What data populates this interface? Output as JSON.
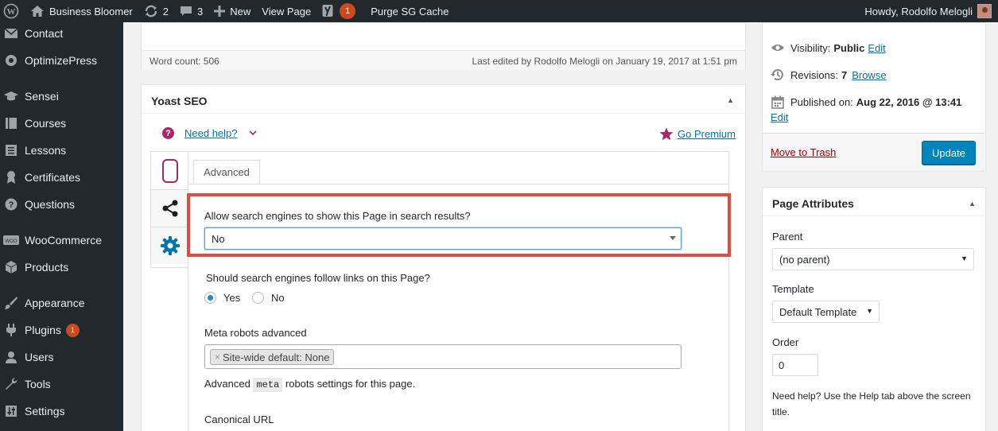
{
  "adminbar": {
    "site_name": "Business Bloomer",
    "updates_count": "2",
    "comments_count": "3",
    "new_label": "New",
    "view_page_label": "View Page",
    "yoast_badge": "1",
    "purge_label": "Purge SG Cache",
    "howdy": "Howdy, Rodolfo Melogli"
  },
  "sidebar": {
    "items": [
      {
        "label": "Contact",
        "icon": "envelope-icon"
      },
      {
        "label": "OptimizePress",
        "icon": "optimizepress-icon"
      },
      {
        "label": "Sensei",
        "icon": "graduation-cap-icon"
      },
      {
        "label": "Courses",
        "icon": "book-icon"
      },
      {
        "label": "Lessons",
        "icon": "list-icon"
      },
      {
        "label": "Certificates",
        "icon": "award-icon"
      },
      {
        "label": "Questions",
        "icon": "question-icon"
      },
      {
        "label": "WooCommerce",
        "icon": "woo-icon"
      },
      {
        "label": "Products",
        "icon": "cube-icon"
      },
      {
        "label": "Appearance",
        "icon": "brush-icon"
      },
      {
        "label": "Plugins",
        "icon": "plug-icon",
        "badge": "1"
      },
      {
        "label": "Users",
        "icon": "user-icon"
      },
      {
        "label": "Tools",
        "icon": "wrench-icon"
      },
      {
        "label": "Settings",
        "icon": "sliders-icon"
      }
    ]
  },
  "editor": {
    "word_count": "Word count: 506",
    "last_edited": "Last edited by Rodolfo Melogli on January 19, 2017 at 1:51 pm"
  },
  "yoast": {
    "title": "Yoast SEO",
    "need_help": "Need help?",
    "go_premium": "Go Premium",
    "tab_advanced": "Advanced",
    "q_show": "Allow search engines to show this Page in search results?",
    "q_show_value": "No",
    "q_follow": "Should search engines follow links on this Page?",
    "opt_yes": "Yes",
    "opt_no": "No",
    "meta_label": "Meta robots advanced",
    "meta_token": "Site-wide default: None",
    "meta_desc_pre": "Advanced",
    "meta_code": "meta",
    "meta_desc_post": "robots settings for this page.",
    "canonical_label": "Canonical URL"
  },
  "publish": {
    "visibility_label": "Visibility:",
    "visibility_value": "Public",
    "edit": "Edit",
    "revisions_label": "Revisions:",
    "revisions_value": "7",
    "browse": "Browse",
    "published_label": "Published on:",
    "published_value": "Aug 22, 2016 @ 13:41",
    "edit2": "Edit",
    "trash": "Move to Trash",
    "update": "Update"
  },
  "page_attributes": {
    "title": "Page Attributes",
    "parent_label": "Parent",
    "parent_value": "(no parent)",
    "template_label": "Template",
    "template_value": "Default Template",
    "order_label": "Order",
    "order_value": "0",
    "help": "Need help? Use the Help tab above the screen title."
  },
  "colors": {
    "adminbar_bg": "#23282d",
    "link": "#0073aa",
    "highlight": "#e14b42",
    "update_button": "#0085ba",
    "yoast_purple": "#a4286a"
  }
}
